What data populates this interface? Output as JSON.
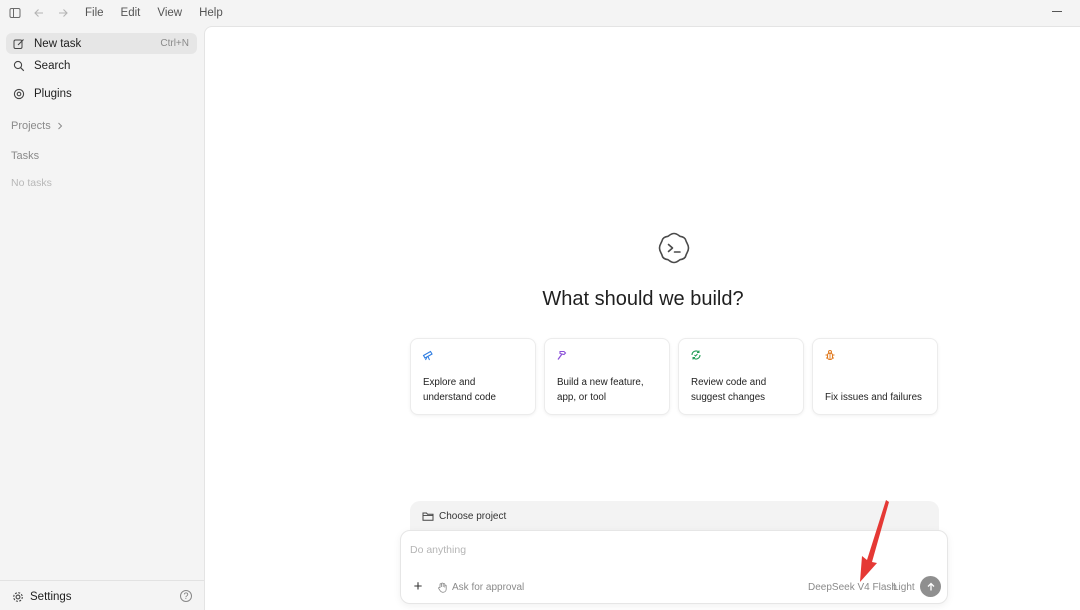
{
  "titlebar": {
    "menu": [
      "File",
      "Edit",
      "View",
      "Help"
    ]
  },
  "sidebar": {
    "new_task": {
      "label": "New task",
      "shortcut": "Ctrl+N"
    },
    "search": "Search",
    "plugins": "Plugins",
    "projects": "Projects",
    "tasks": "Tasks",
    "no_tasks": "No tasks",
    "settings": "Settings",
    "help": "?"
  },
  "main": {
    "headline": "What should we build?",
    "cards": [
      {
        "label": "Explore and understand code",
        "icon": "telescope-icon",
        "color": "#2f7de1"
      },
      {
        "label": "Build a new feature, app, or tool",
        "icon": "hammer-icon",
        "color": "#8a4fd8"
      },
      {
        "label": "Review code and suggest changes",
        "icon": "refresh-check-icon",
        "color": "#1f9d55"
      },
      {
        "label": "Fix issues and failures",
        "icon": "bug-icon",
        "color": "#e07a1f"
      }
    ],
    "project_bar": {
      "label": "Choose project",
      "icon": "folder-icon"
    },
    "composer": {
      "placeholder": "Do anything",
      "approval": "Ask for approval",
      "model": "DeepSeek V4 Flash",
      "mode": "Light"
    }
  },
  "annotation": {
    "color": "#e53935"
  }
}
